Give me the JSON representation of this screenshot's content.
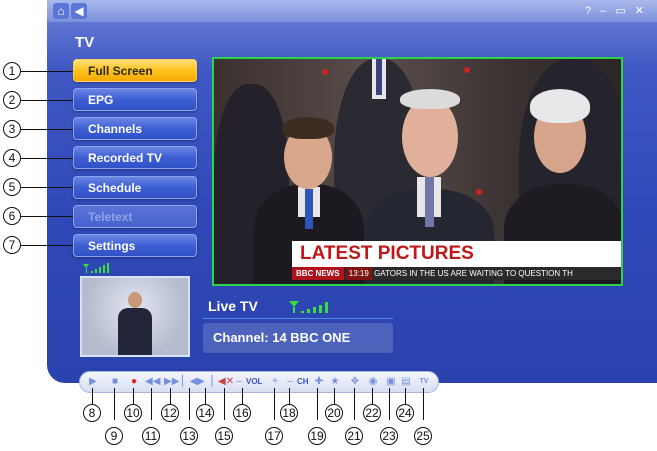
{
  "window": {
    "section_title": "TV",
    "home_icon": "home-icon",
    "back_icon": "back-arrow-icon",
    "controls": "? – ▭ ✕"
  },
  "menu": [
    {
      "label": "Full Screen",
      "state": "active"
    },
    {
      "label": "EPG",
      "state": "normal"
    },
    {
      "label": "Channels",
      "state": "normal"
    },
    {
      "label": "Recorded TV",
      "state": "normal"
    },
    {
      "label": "Schedule",
      "state": "normal"
    },
    {
      "label": "Teletext",
      "state": "disabled"
    },
    {
      "label": "Settings",
      "state": "normal"
    }
  ],
  "video": {
    "headline": "LATEST PICTURES",
    "bbc": "BBC NEWS",
    "time": "13:19",
    "ticker": "GATORS IN THE US ARE WAITING TO QUESTION TH"
  },
  "signal_icon": "signal-strength-icon",
  "live": {
    "label": "Live TV",
    "channel": "Channel: 14 BBC ONE"
  },
  "toolbar": {
    "vol_label": "VOL",
    "ch_label": "CH",
    "play": "play-icon",
    "stop": "stop-icon",
    "record": "record-icon",
    "rewind": "rewind-icon",
    "fast_forward": "fast-forward-icon",
    "skip_back": "skip-back-icon",
    "skip_forward": "skip-forward-icon",
    "mute": "mute-icon",
    "vol_down": "volume-down-icon",
    "vol_up": "volume-up-icon",
    "ch_down": "channel-down-icon",
    "ch_up": "channel-up-icon",
    "favorite": "favorite-star-icon",
    "full_screen": "full-screen-icon",
    "search": "search-icon",
    "snapshot": "snapshot-camera-icon",
    "teletext": "teletext-icon",
    "tv_logo": "tv-logo-icon"
  },
  "callouts": [
    "1",
    "2",
    "3",
    "4",
    "5",
    "6",
    "7",
    "8",
    "9",
    "10",
    "11",
    "12",
    "13",
    "14",
    "15",
    "16",
    "17",
    "18",
    "19",
    "20",
    "21",
    "22",
    "23",
    "24",
    "25"
  ],
  "colors": {
    "app_bg": "#2f49b8",
    "active_button": "#ffc21c",
    "video_border": "#2bd24a",
    "headline_red": "#c01818"
  }
}
